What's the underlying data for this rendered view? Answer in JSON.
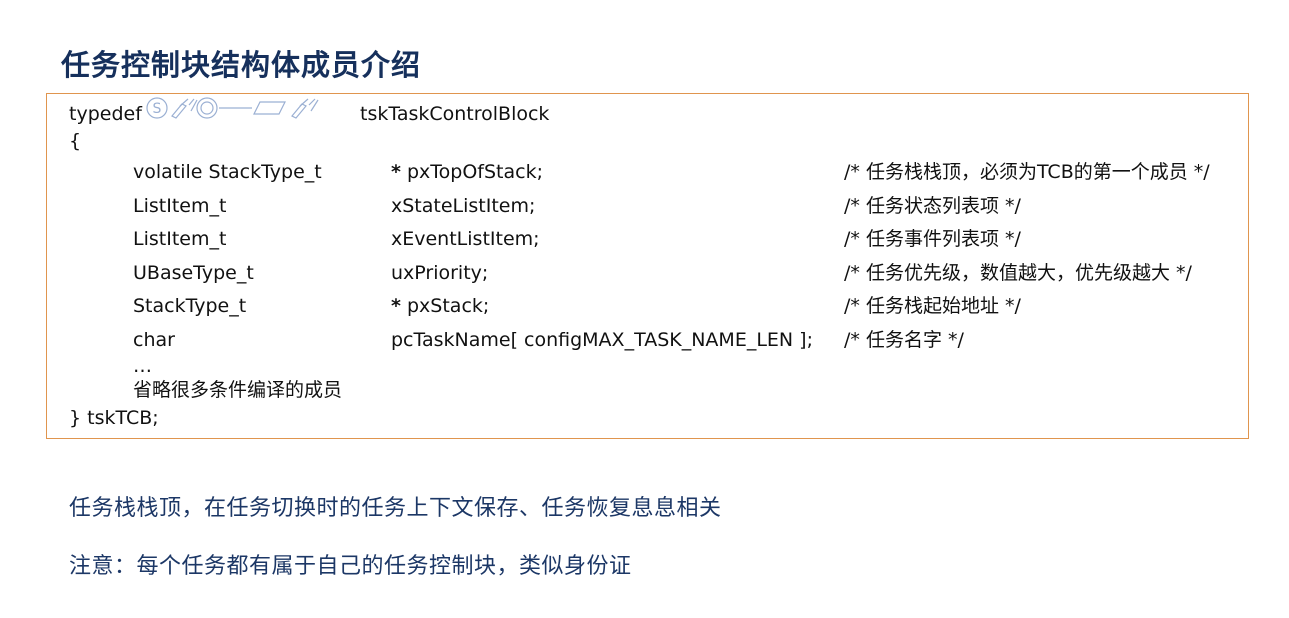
{
  "slide": {
    "title": "任务控制块结构体成员介绍",
    "code": {
      "typedef_keyword": "typedef",
      "struct_name": "tskTaskControlBlock",
      "open_brace": "{",
      "members": [
        {
          "type": "volatile StackType_t",
          "ptr": "*",
          "name": "pxTopOfStack;",
          "comment": "/* 任务栈栈顶，必须为TCB的第一个成员 */"
        },
        {
          "type": "ListItem_t",
          "ptr": "",
          "name": "xStateListItem;",
          "comment": "/* 任务状态列表项 */"
        },
        {
          "type": "ListItem_t",
          "ptr": "",
          "name": "xEventListItem;",
          "comment": "/* 任务事件列表项 */"
        },
        {
          "type": "UBaseType_t",
          "ptr": "",
          "name": "uxPriority;",
          "comment": "/* 任务优先级，数值越大，优先级越大 */"
        },
        {
          "type": "StackType_t",
          "ptr": "*",
          "name": "pxStack;",
          "comment": "/* 任务栈起始地址 */"
        },
        {
          "type": "char",
          "ptr": "",
          "name": "pcTaskName[ configMAX_TASK_NAME_LEN ];",
          "comment": "/* 任务名字 */"
        }
      ],
      "ellipsis": "…",
      "omitted_note": "省略很多条件编译的成员",
      "close_line": "} tskTCB;"
    },
    "notes": [
      "任务栈栈顶，在任务切换时的任务上下文保存、任务恢复息息相关",
      "注意：每个任务都有属于自己的任务控制块，类似身份证"
    ]
  },
  "colors": {
    "title": "#16305c",
    "box_border": "#e0954e",
    "note_text": "#1c3766",
    "icon_stroke": "#9bb0d3"
  }
}
